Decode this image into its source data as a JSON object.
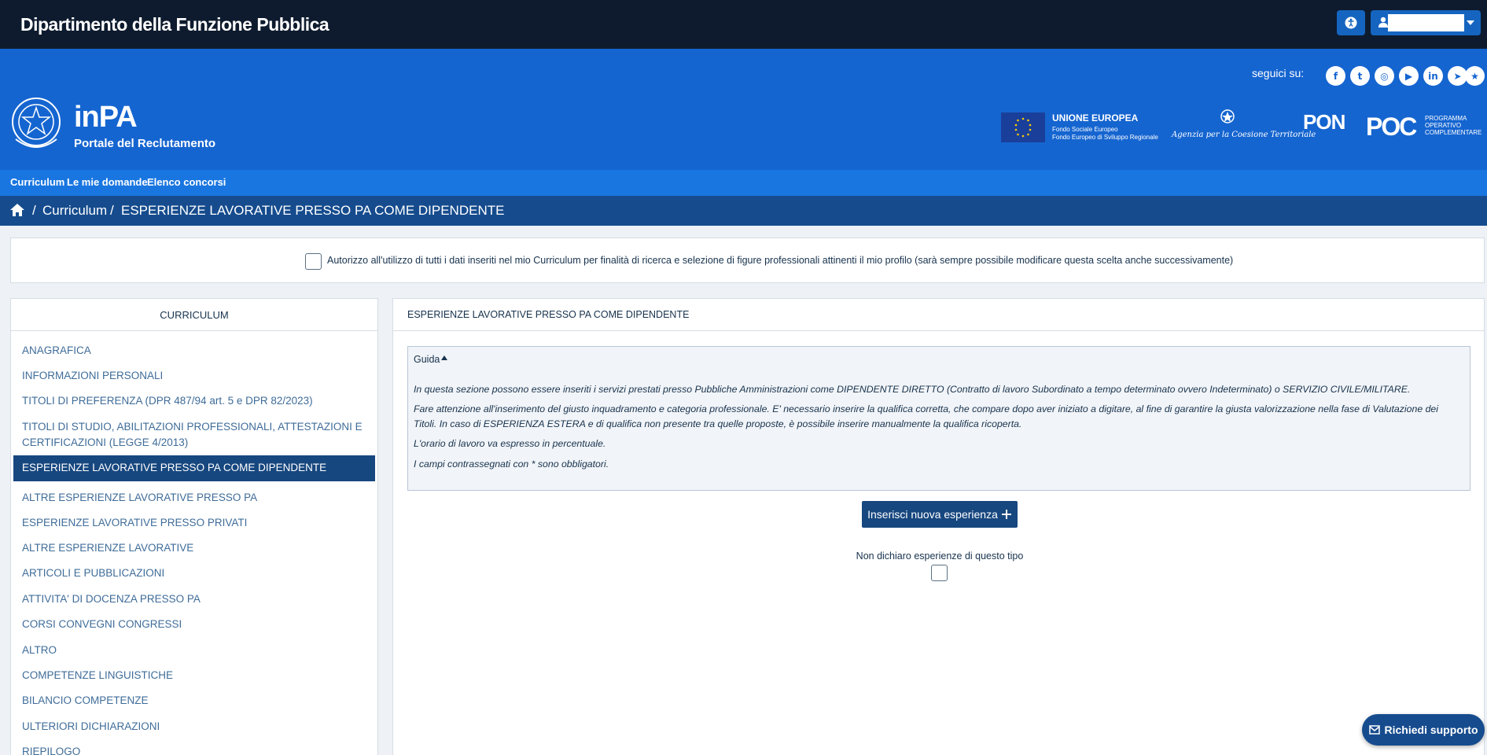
{
  "topbar": {
    "brand": "Dipartimento della Funzione Pubblica",
    "accessibility_icon": "accessibility-icon",
    "user_icon": "user-icon"
  },
  "header": {
    "follow_label": "seguici su:",
    "social": [
      "facebook-icon",
      "twitter-icon",
      "instagram-icon",
      "youtube-icon",
      "linkedin-icon",
      "telegram-icon",
      "star-icon"
    ],
    "logo_title": "inPA",
    "logo_subtitle": "Portale del Reclutamento",
    "eu_title": "UNIONE EUROPEA",
    "eu_line1": "Fondo Sociale Europeo",
    "eu_line2": "Fondo Europeo di Sviluppo Regionale",
    "agency": "Agenzia per la Coesione Territoriale",
    "pon": "PON",
    "poc": "POC",
    "poc_text": [
      "PROGRAMMA",
      "OPERATIVO",
      "COMPLEMENTARE"
    ]
  },
  "nav": {
    "items": [
      "Curriculum",
      "Le mie domande",
      "Elenco concorsi"
    ]
  },
  "breadcrumb": {
    "items": [
      "Curriculum",
      "ESPERIENZE LAVORATIVE PRESSO PA COME DIPENDENTE"
    ],
    "separator": "/"
  },
  "consent": {
    "label": "Autorizzo all'utilizzo di tutti i dati inseriti nel mio Curriculum per finalità di ricerca e selezione di figure professionali attinenti il mio profilo (sarà sempre possibile modificare questa scelta anche successivamente)",
    "checked": false
  },
  "sidebar": {
    "title": "CURRICULUM",
    "items": [
      {
        "label": "ANAGRAFICA"
      },
      {
        "label": "INFORMAZIONI PERSONALI"
      },
      {
        "label": "TITOLI DI PREFERENZA (DPR 487/94 art. 5 e DPR 82/2023)"
      },
      {
        "label": "TITOLI DI STUDIO, ABILITAZIONI PROFESSIONALI, ATTESTAZIONI E CERTIFICAZIONI (LEGGE 4/2013)"
      },
      {
        "label": "ESPERIENZE LAVORATIVE PRESSO PA COME DIPENDENTE",
        "active": true
      },
      {
        "label": "ALTRE ESPERIENZE LAVORATIVE PRESSO PA"
      },
      {
        "label": "ESPERIENZE LAVORATIVE PRESSO PRIVATI"
      },
      {
        "label": "ALTRE ESPERIENZE LAVORATIVE"
      },
      {
        "label": "ARTICOLI E PUBBLICAZIONI"
      },
      {
        "label": "ATTIVITA' DI DOCENZA PRESSO PA"
      },
      {
        "label": "CORSI CONVEGNI CONGRESSI"
      },
      {
        "label": "ALTRO"
      },
      {
        "label": "COMPETENZE LINGUISTICHE"
      },
      {
        "label": "BILANCIO COMPETENZE"
      },
      {
        "label": "ULTERIORI DICHIARAZIONI"
      },
      {
        "label": "RIEPILOGO"
      }
    ]
  },
  "main": {
    "title": "ESPERIENZE LAVORATIVE PRESSO PA COME DIPENDENTE",
    "guide_title": "Guida",
    "guide_lines": [
      "In questa sezione possono essere inseriti i servizi prestati presso Pubbliche Amministrazioni come DIPENDENTE DIRETTO (Contratto di lavoro Subordinato a tempo determinato ovvero Indeterminato) o SERVIZIO CIVILE/MILITARE.",
      "Fare attenzione all'inserimento del giusto inquadramento e categoria professionale. E' necessario inserire la qualifica corretta, che compare dopo aver iniziato a digitare, al fine di garantire la giusta valorizzazione nella fase di Valutazione dei Titoli. In caso di ESPERIENZA ESTERA e di qualifica non presente tra quelle proposte, è possibile inserire manualmente la qualifica ricoperta.",
      "L'orario di lavoro va espresso in percentuale.",
      "I campi contrassegnati con * sono obbligatori."
    ],
    "add_button": "Inserisci nuova esperienza",
    "no_declare_label": "Non dichiaro esperienze di questo tipo",
    "no_declare_checked": false
  },
  "support": {
    "label": "Richiedi supporto"
  },
  "colors": {
    "topbar": "#0e1b2e",
    "header": "#1565d0",
    "nav": "#1976e0",
    "breadcrumb": "#164c8e",
    "active": "#17477f"
  }
}
